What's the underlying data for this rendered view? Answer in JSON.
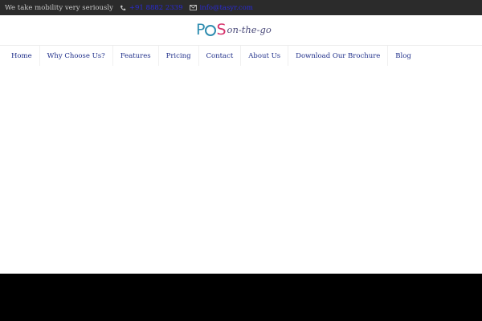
{
  "topbar": {
    "tagline": "We take mobility very seriously",
    "phone_icon": "phone-icon",
    "phone": "+91 8882 2339",
    "mail_icon": "mail-icon",
    "email": "info@tasyr.com"
  },
  "logo": {
    "p": "P",
    "s": "S",
    "tail": "on-the-go",
    "colors": {
      "blue": "#2f8db0",
      "pink": "#d6336c"
    }
  },
  "nav": {
    "items": [
      {
        "label": "Home"
      },
      {
        "label": "Why Choose Us?"
      },
      {
        "label": "Features"
      },
      {
        "label": "Pricing"
      },
      {
        "label": "Contact"
      },
      {
        "label": "About Us"
      },
      {
        "label": "Download Our Brochure"
      },
      {
        "label": "Blog"
      }
    ]
  }
}
